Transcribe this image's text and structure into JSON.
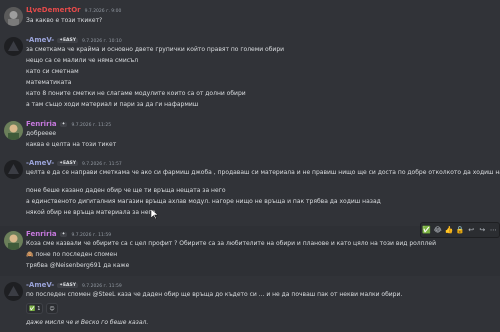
{
  "messages": [
    {
      "name": "ЦveDemertOr",
      "time": "9.7.2026 г. 9:00",
      "lines": [
        "За какво е този ткикет?"
      ]
    },
    {
      "name": "-AmeV-",
      "tag": "✦EASY",
      "time": "9.7.2026 г. 10:10",
      "lines": [
        "за сметкама че крайма и основно двете групички който правят по големи обири",
        "нещо са се малили че няма смисъл",
        "като си сметнам",
        "математиката",
        "като 8 поните сметки не слагаме модулите които са от долни обири",
        "а там също ходи материал и пари за да ги нафармиш"
      ]
    },
    {
      "name": "Fenriria",
      "tag": "✦",
      "time": "9.7.2026 г. 11:25",
      "lines": [
        "добрееее",
        "каква е целта на този тикет"
      ]
    },
    {
      "name": "-AmeV-",
      "tag": "✦EASY",
      "time": "9.7.2026 г. 11:57",
      "lines": [
        "целта е да се направи сметкама че ако си фармиш джоба , продаваш си материала и не правиш нищо ще си доста по добре отколкото да ходиш на обири",
        "поне беше казано даден обир че ще ти връща нещата за него",
        "а единственото дигиталния магазин връща ахлав модул. нагоре нищо не връща и пак трябва да ходиш назад",
        "някой обир не връща материала за него"
      ]
    },
    {
      "name": "Fenriria",
      "tag": "✦",
      "time": "9.7.2026 г. 11:59",
      "lines": [
        "Коза сме казвали че обирите са с цел профит ? Обирите са за любителите на обири и планове и като цяло на този вид ролплей",
        "поне по последен спомен",
        "трябва @Neisenberg691 да каже"
      ]
    },
    {
      "name": "-AmeV-",
      "tag": "✦EASY",
      "time": "9.7.2026 г. 11:59",
      "lines": [
        "по последен спомен @SteeL каза че даден обир ще връща до където си ... и не да почваш пак от некви малки обири.",
        "даже мисля че и Веско го беше казал."
      ]
    }
  ],
  "reactions": [
    {
      "emoji": "✅",
      "count": "1"
    }
  ],
  "toolbar": [
    "✅",
    "😂",
    "👍",
    "🔒",
    "↩",
    "↪",
    "⋯"
  ],
  "colors": {
    "bg": "#313338",
    "text": "#dbdee1",
    "time": "#949ba4",
    "mention": "#c9cdfb"
  }
}
